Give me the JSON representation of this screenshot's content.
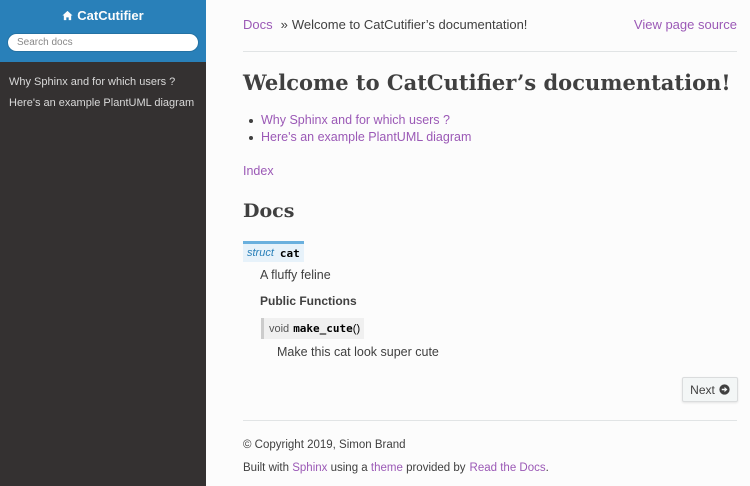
{
  "sidebar": {
    "project_name": "CatCutifier",
    "search_placeholder": "Search docs",
    "items": [
      {
        "label": "Why Sphinx and for which users ?"
      },
      {
        "label": "Here's an example PlantUML diagram"
      }
    ]
  },
  "breadcrumbs": {
    "docs_link": "Docs",
    "separator": "»",
    "current": "Welcome to CatCutifier’s documentation!",
    "view_source": "View page source"
  },
  "page": {
    "title": "Welcome to CatCutifier’s documentation!",
    "toc": [
      {
        "label": "Why Sphinx and for which users ?"
      },
      {
        "label": "Here's an example PlantUML diagram"
      }
    ],
    "index_link": "Index",
    "docs_heading": "Docs",
    "struct_keyword": "struct",
    "struct_name": "cat",
    "struct_desc": "A fluffy feline",
    "public_functions_heading": "Public Functions",
    "func_return": "void",
    "func_name": "make_cute",
    "func_parens": "()",
    "func_desc": "Make this cat look super cute"
  },
  "nav": {
    "next_label": "Next"
  },
  "footer": {
    "copyright": "© Copyright 2019, Simon Brand",
    "built_with": "Built with",
    "sphinx": "Sphinx",
    "using_a": "using a",
    "theme": "theme",
    "provided_by": "provided by",
    "read_the_docs": "Read the Docs",
    "period": "."
  },
  "colors": {
    "sidebar_bg": "#343131",
    "header_bg": "#2980b9",
    "link": "#9b59b6",
    "text": "#404040"
  },
  "icons": {
    "home": "home-icon",
    "next_arrow": "arrow-circle-right-icon"
  }
}
